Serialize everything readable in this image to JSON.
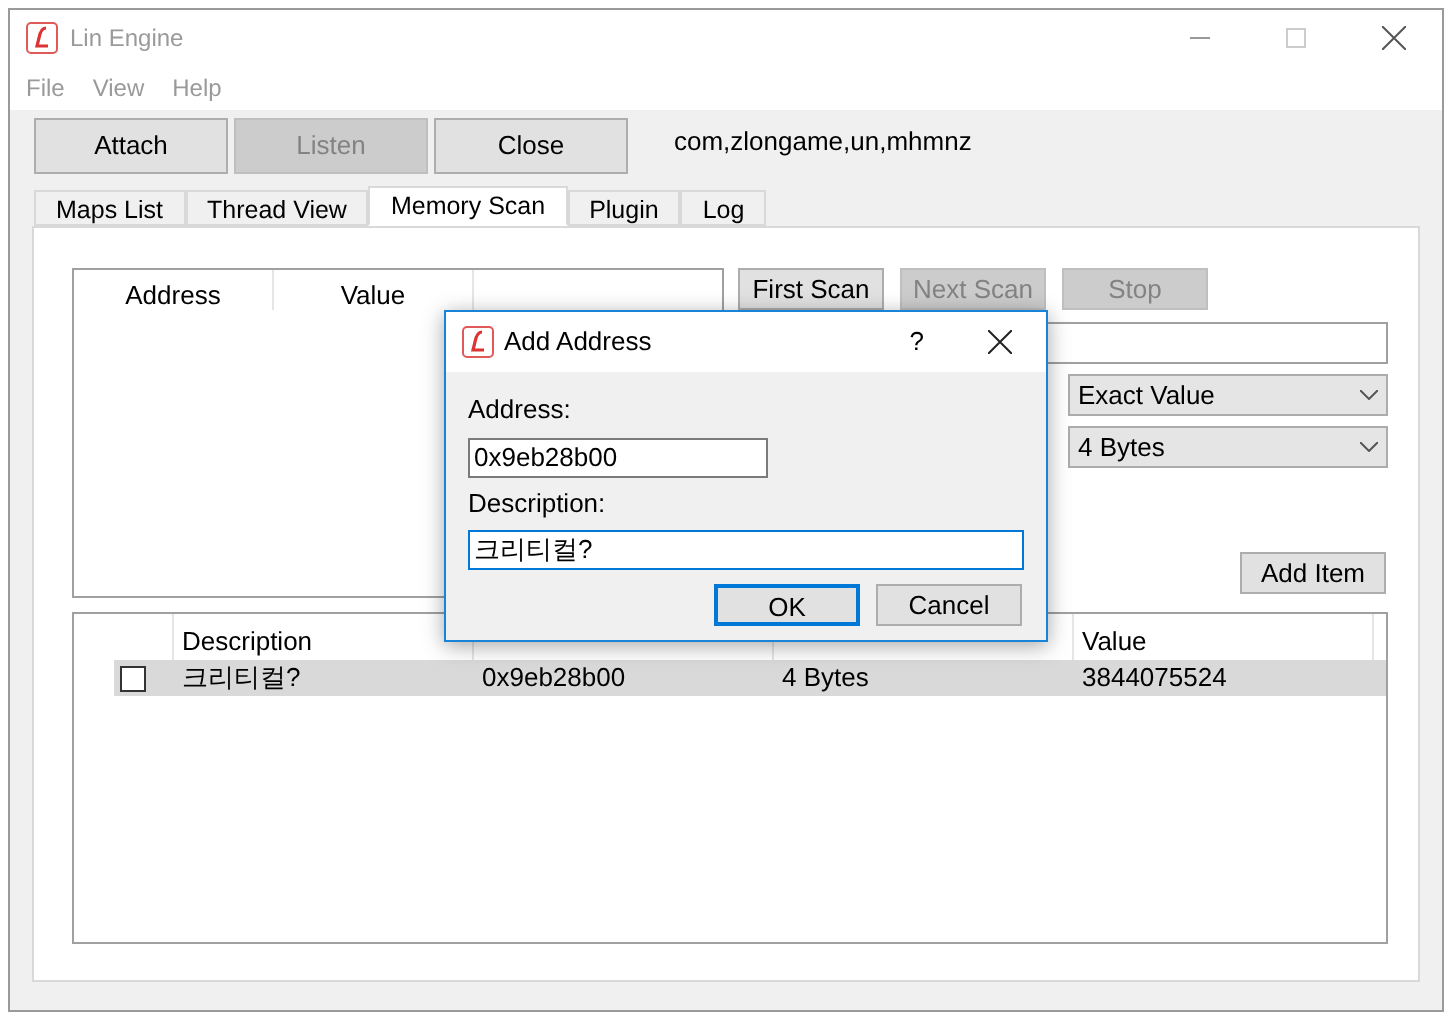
{
  "window": {
    "title": "Lin Engine",
    "active": false
  },
  "menu": [
    "File",
    "View",
    "Help"
  ],
  "toolbar": {
    "buttons": [
      {
        "label": "Attach",
        "disabled": false
      },
      {
        "label": "Listen",
        "disabled": true
      },
      {
        "label": "Close",
        "disabled": false
      }
    ],
    "process": "com,zlongame,un,mhmnz"
  },
  "tabs": [
    {
      "label": "Maps List",
      "selected": false
    },
    {
      "label": "Thread View",
      "selected": false
    },
    {
      "label": "Memory Scan",
      "selected": true
    },
    {
      "label": "Plugin",
      "selected": false
    },
    {
      "label": "Log",
      "selected": false
    }
  ],
  "results_table": {
    "columns": [
      "Address",
      "Value"
    ]
  },
  "scan_buttons": [
    {
      "label": "First Scan",
      "disabled": false
    },
    {
      "label": "Next Scan",
      "disabled": true
    },
    {
      "label": "Stop",
      "disabled": true
    }
  ],
  "scan_type": "Exact Value",
  "value_type": "4 Bytes",
  "add_item": "Add Item",
  "saved_table": {
    "columns": [
      "Description",
      "",
      "",
      "Value"
    ],
    "rows": [
      {
        "checked": false,
        "selected": true,
        "cells": [
          "크리티컬?",
          "0x9eb28b00",
          "4 Bytes",
          "3844075524"
        ]
      }
    ]
  },
  "dialog": {
    "title": "Add Address",
    "help": "?",
    "address_label": "Address:",
    "address": "0x9eb28b00",
    "description_label": "Description:",
    "description": "크리티컬?",
    "buttons": [
      {
        "label": "OK",
        "default": true
      },
      {
        "label": "Cancel",
        "default": false
      }
    ]
  }
}
